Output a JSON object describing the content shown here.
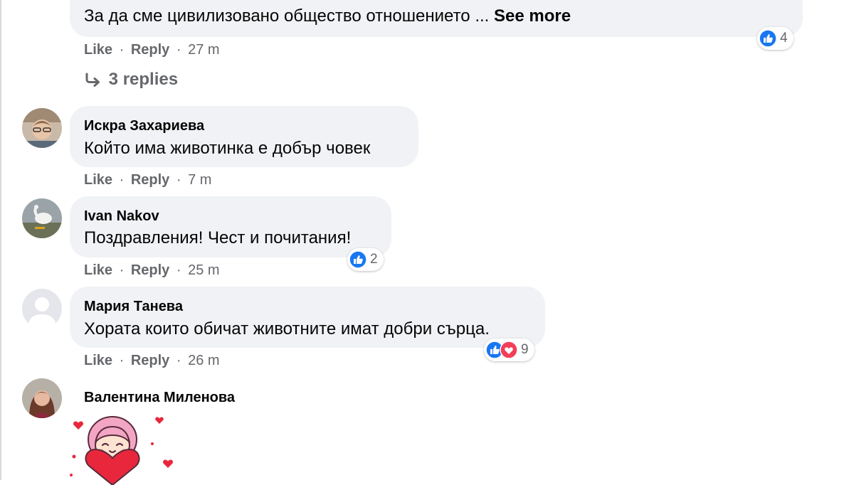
{
  "comments": [
    {
      "author": "",
      "text": "За да сме цивилизовано общество отношението ...",
      "see_more": "See more",
      "actions": {
        "like": "Like",
        "reply": "Reply",
        "time": "27 m"
      },
      "reactions": {
        "types": [
          "like-icon"
        ],
        "count": "4"
      }
    },
    {
      "author": "Искра Захариева",
      "text": "Който има животинка е добър човек",
      "actions": {
        "like": "Like",
        "reply": "Reply",
        "time": "7 m"
      }
    },
    {
      "author": "Ivan Nakov",
      "text": "Поздравления! Чест и почитания!",
      "actions": {
        "like": "Like",
        "reply": "Reply",
        "time": "25 m"
      },
      "reactions": {
        "types": [
          "like-icon"
        ],
        "count": "2"
      }
    },
    {
      "author": "Мария Танева",
      "text": "Хората които обичат животните имат добри сърца.",
      "actions": {
        "like": "Like",
        "reply": "Reply",
        "time": "26 m"
      },
      "reactions": {
        "types": [
          "like-icon",
          "love-icon"
        ],
        "count": "9"
      }
    },
    {
      "author": "Валентина Миленова",
      "sticker": "girl-holding-heart-sticker"
    }
  ],
  "replies_link": "3 replies",
  "separator": "·",
  "colors": {
    "bubble": "#f0f2f5",
    "meta_text": "#65676b",
    "like_blue": "#1877f2",
    "love_red": "#f33e58"
  }
}
